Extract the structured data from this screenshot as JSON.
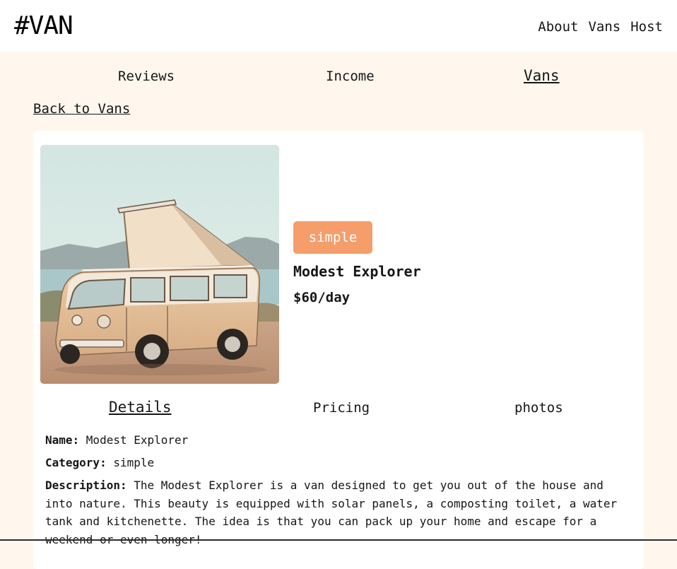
{
  "header": {
    "logo": "#VAN",
    "nav": [
      "About",
      "Vans",
      "Host"
    ]
  },
  "host_nav": {
    "items": [
      "Reviews",
      "Income",
      "Vans"
    ],
    "active": "Vans"
  },
  "back_link": "Back to Vans",
  "van": {
    "type": "simple",
    "name": "Modest Explorer",
    "price": "$60/day",
    "photo_icon": "van-photo"
  },
  "tabs": {
    "items": [
      "Details",
      "Pricing",
      "photos"
    ],
    "active": "Details"
  },
  "details": {
    "name_label": "Name:",
    "name_value": "Modest Explorer",
    "category_label": "Category:",
    "category_value": "simple",
    "description_label": "Description:",
    "description_value": "The Modest Explorer is a van designed to get you out of the house and into nature. This beauty is equipped with solar panels, a composting toilet, a water tank and kitchenette. The idea is that you can pack up your home and escape for a weekend or even longer!"
  },
  "colors": {
    "page_bg": "#FFF7ED",
    "card_bg": "#FFFFFF",
    "badge_simple": "#F59E6B",
    "text": "#161616"
  }
}
